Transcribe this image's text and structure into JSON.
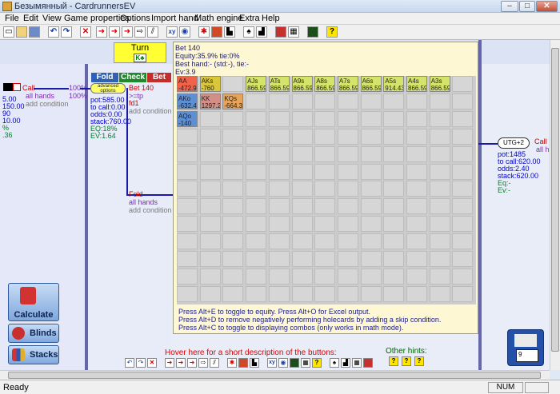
{
  "window": {
    "title": "Безымянный - CardrunnersEV",
    "min": "–",
    "max": "□",
    "close": "✕"
  },
  "menu": [
    "File",
    "Edit",
    "View",
    "Game properties",
    "Options",
    "Import hand",
    "Math engine",
    "Extra",
    "Help"
  ],
  "toolbar_icons": [
    "new-icon",
    "open-icon",
    "save-icon",
    "undo-icon",
    "redo-icon",
    "delete-icon",
    "arrow-red-icon",
    "arrow-red2-icon",
    "arrow-red3-icon",
    "arrow-outline-icon",
    "chart-icon",
    "xy-icon",
    "circle-icon",
    "bomb-icon",
    "bars-icon",
    "tree-icon",
    "deck-icon",
    "card-icon",
    "grid-icon",
    "matrix-icon",
    "help-icon"
  ],
  "street": {
    "label": "Turn",
    "card": "K♣"
  },
  "left_node": {
    "call": "Call",
    "all_hands": "all hands",
    "add_condition": "add condition",
    "pct1": "100%",
    "pct2": "100%",
    "stats": [
      "5.00",
      "150.00",
      "90",
      "10.00",
      "%",
      ".36"
    ]
  },
  "actions": {
    "fold": "Fold",
    "check": "Check",
    "bet": "Bet",
    "advanced": "advanced options"
  },
  "mid_node": {
    "pot": "pot:585.00",
    "to_call": "to call:0.00",
    "odds": "odds:0.00",
    "stack": "stack:760.00",
    "eq": "EQ:18%",
    "ev": "EV:1.64"
  },
  "bet_branch": {
    "label": "Bet 140",
    "range": ">=tp",
    "fd": "fd1",
    "add_condition": "add condition"
  },
  "fold_branch": {
    "label": "Fold",
    "all_hands": "all hands",
    "add_condition": "add condition"
  },
  "popup": {
    "line1": "Bet 140",
    "line2": "Equity:35.9% tie:0%",
    "line3": "Best hand:- (std:-), tie:-",
    "line4": "Ev:3.9",
    "cells": [
      {
        "hand": "AA",
        "ev": "-472.9",
        "color": "#f0624a",
        "col": 0,
        "row": 0
      },
      {
        "hand": "AKs",
        "ev": "-760",
        "color": "#d9c63b",
        "col": 1,
        "row": 0
      },
      {
        "hand": "AJs",
        "ev": "866.59",
        "color": "#d4e36a",
        "col": 3,
        "row": 0
      },
      {
        "hand": "ATs",
        "ev": "866.59",
        "color": "#d4e36a",
        "col": 4,
        "row": 0
      },
      {
        "hand": "A9s",
        "ev": "866.59",
        "color": "#d4e36a",
        "col": 5,
        "row": 0
      },
      {
        "hand": "A8s",
        "ev": "866.59",
        "color": "#d4e36a",
        "col": 6,
        "row": 0
      },
      {
        "hand": "A7s",
        "ev": "866.59",
        "color": "#d4e36a",
        "col": 7,
        "row": 0
      },
      {
        "hand": "A6s",
        "ev": "866.59",
        "color": "#d4e36a",
        "col": 8,
        "row": 0
      },
      {
        "hand": "A5s",
        "ev": "914.43",
        "color": "#d4e36a",
        "col": 9,
        "row": 0
      },
      {
        "hand": "A4s",
        "ev": "866.59",
        "color": "#d4e36a",
        "col": 10,
        "row": 0
      },
      {
        "hand": "A3s",
        "ev": "866.59",
        "color": "#d4e36a",
        "col": 11,
        "row": 0
      },
      {
        "hand": "AKo",
        "ev": "-632.4",
        "color": "#5f8fd3",
        "col": 0,
        "row": 1
      },
      {
        "hand": "KK",
        "ev": "1297.2",
        "color": "#d38f86",
        "col": 1,
        "row": 1
      },
      {
        "hand": "KQs",
        "ev": "-664.3",
        "color": "#e7a35a",
        "col": 2,
        "row": 1
      },
      {
        "hand": "AQo",
        "ev": "-140",
        "color": "#5f8fd3",
        "col": 0,
        "row": 2
      }
    ],
    "hints": [
      "Press Alt+E to toggle to equity. Press Alt+O for Excel output.",
      "Press Alt+D to remove negatively performing holecards by adding a skip condition.",
      "Press Alt+C to toggle to displaying combos (only works in math mode)."
    ]
  },
  "right_node": {
    "utg": "UTG+2",
    "call": "Call",
    "all": "all h",
    "pot": "pot:1485",
    "to_call": "to call:620.00",
    "odds": "odds:2.40",
    "stack": "stack:620.00",
    "eq": "Eq:-",
    "ev": "Ev:-"
  },
  "buttons": {
    "calculate": "Calculate",
    "blinds": "Blinds",
    "stacks": "Stacks"
  },
  "hover_text": "Hover here for a short description of the buttons:",
  "other_hints": "Other hints:",
  "status": {
    "ready": "Ready",
    "num": "NUM"
  },
  "save_badge": "9"
}
